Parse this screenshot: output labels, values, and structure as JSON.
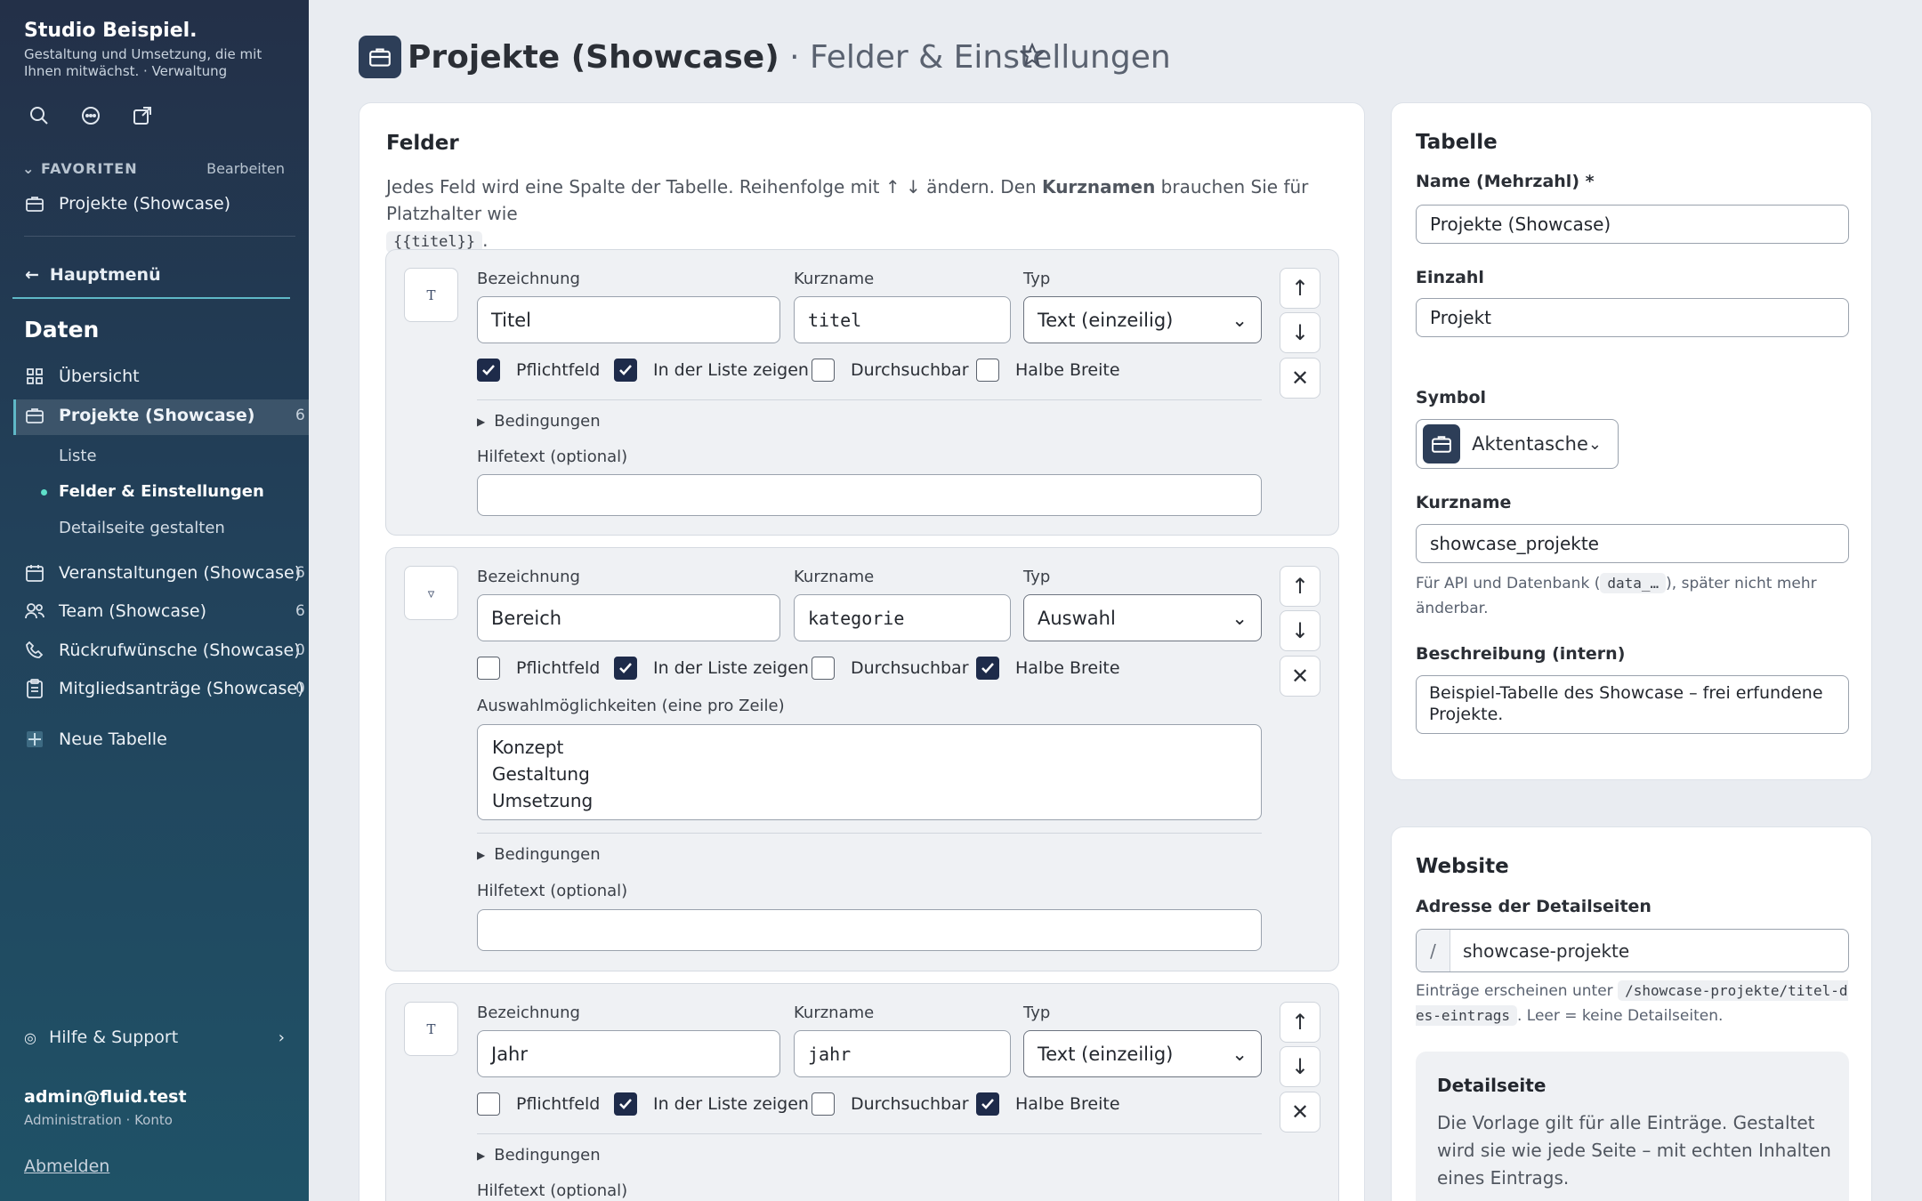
{
  "sidebar": {
    "brand": "Studio Beispiel.",
    "tagline": "Gestaltung und Umsetzung, die mit Ihnen mitwächst. · Verwaltung",
    "icons": [
      "search-icon",
      "chat-icon",
      "external-link-icon"
    ],
    "favorites_label": "FAVORITEN",
    "favorites_edit": "Bearbeiten",
    "favorite_item": "Projekte (Showcase)",
    "back_label": "Hauptmenü",
    "section_title": "Daten",
    "items": [
      {
        "label": "Übersicht",
        "icon": "grid-icon",
        "count": ""
      },
      {
        "label": "Projekte (Showcase)",
        "icon": "briefcase-icon",
        "count": "6"
      },
      {
        "label": "Veranstaltungen (Showcase)",
        "icon": "calendar-icon",
        "count": "6"
      },
      {
        "label": "Team (Showcase)",
        "icon": "users-icon",
        "count": "6"
      },
      {
        "label": "Rückrufwünsche (Showcase)",
        "icon": "phone-icon",
        "count": "0"
      },
      {
        "label": "Mitgliedsanträge (Showcase)",
        "icon": "clipboard-icon",
        "count": "0"
      },
      {
        "label": "Neue Tabelle",
        "icon": "plus-grid-icon",
        "count": ""
      }
    ],
    "subitems": [
      "Liste",
      "Felder & Einstellungen",
      "Detailseite gestalten"
    ],
    "help_label": "Hilfe & Support",
    "user_email": "admin@fluid.test",
    "user_sub": "Administration · Konto",
    "logout": "Abmelden"
  },
  "header": {
    "title": "Projekte (Showcase)",
    "subtitle": "· Felder & Einstellungen"
  },
  "fields_panel": {
    "title": "Felder",
    "intro_a": "Jedes Feld wird eine Spalte der Tabelle. Reihenfolge mit ↑ ↓ ändern. Den",
    "intro_bold": "Kurznamen",
    "intro_b": "brauchen Sie für Platzhalter wie",
    "intro_code": "{{titel}}",
    "intro_end": ".",
    "labels": {
      "bezeichnung": "Bezeichnung",
      "kurzname": "Kurzname",
      "typ": "Typ",
      "pflicht": "Pflichtfeld",
      "liste": "In der Liste zeigen",
      "suche": "Durchsuchbar",
      "halb": "Halbe Breite",
      "bedingungen": "Bedingungen",
      "hilfetext": "Hilfetext (optional)",
      "auswahl": "Auswahlmöglichkeiten (eine pro Zeile)"
    },
    "fields": [
      {
        "type_icon": "T",
        "bezeichnung": "Titel",
        "kurzname": "titel",
        "typ": "Text (einzeilig)",
        "pflicht": true,
        "liste": true,
        "suche": false,
        "halb": false,
        "hilfetext": ""
      },
      {
        "type_icon": "▿",
        "bezeichnung": "Bereich",
        "kurzname": "kategorie",
        "typ": "Auswahl",
        "pflicht": false,
        "liste": true,
        "suche": false,
        "halb": true,
        "options": [
          "Konzept",
          "Gestaltung",
          "Umsetzung"
        ],
        "hilfetext": ""
      },
      {
        "type_icon": "T",
        "bezeichnung": "Jahr",
        "kurzname": "jahr",
        "typ": "Text (einzeilig)",
        "pflicht": false,
        "liste": true,
        "suche": false,
        "halb": true,
        "hilfetext": ""
      }
    ],
    "controls": {
      "up": "↑",
      "down": "↓",
      "remove": "✕"
    }
  },
  "table_panel": {
    "title": "Tabelle",
    "name_label": "Name (Mehrzahl) *",
    "name_value": "Projekte (Showcase)",
    "singular_label": "Einzahl",
    "singular_value": "Projekt",
    "symbol_label": "Symbol",
    "symbol_value": "Aktentasche",
    "kurzname_label": "Kurzname",
    "kurzname_value": "showcase_projekte",
    "kurzname_hint_a": "Für API und Datenbank (",
    "kurzname_hint_code": "data_…",
    "kurzname_hint_b": "), später nicht mehr änderbar.",
    "desc_label": "Beschreibung (intern)",
    "desc_value": "Beispiel-Tabelle des Showcase – frei erfundene Projekte."
  },
  "website_panel": {
    "title": "Website",
    "url_label": "Adresse der Detailseiten",
    "url_prefix": "/",
    "url_value": "showcase-projekte",
    "hint_a": "Einträge erscheinen unter",
    "hint_code": "/showcase-projekte/titel-des-eintrags",
    "hint_b": ". Leer = keine Detailseiten.",
    "detail_title": "Detailseite",
    "detail_text": "Die Vorlage gilt für alle Einträge. Gestaltet wird sie wie jede Seite – mit echten Inhalten eines Eintrags."
  }
}
